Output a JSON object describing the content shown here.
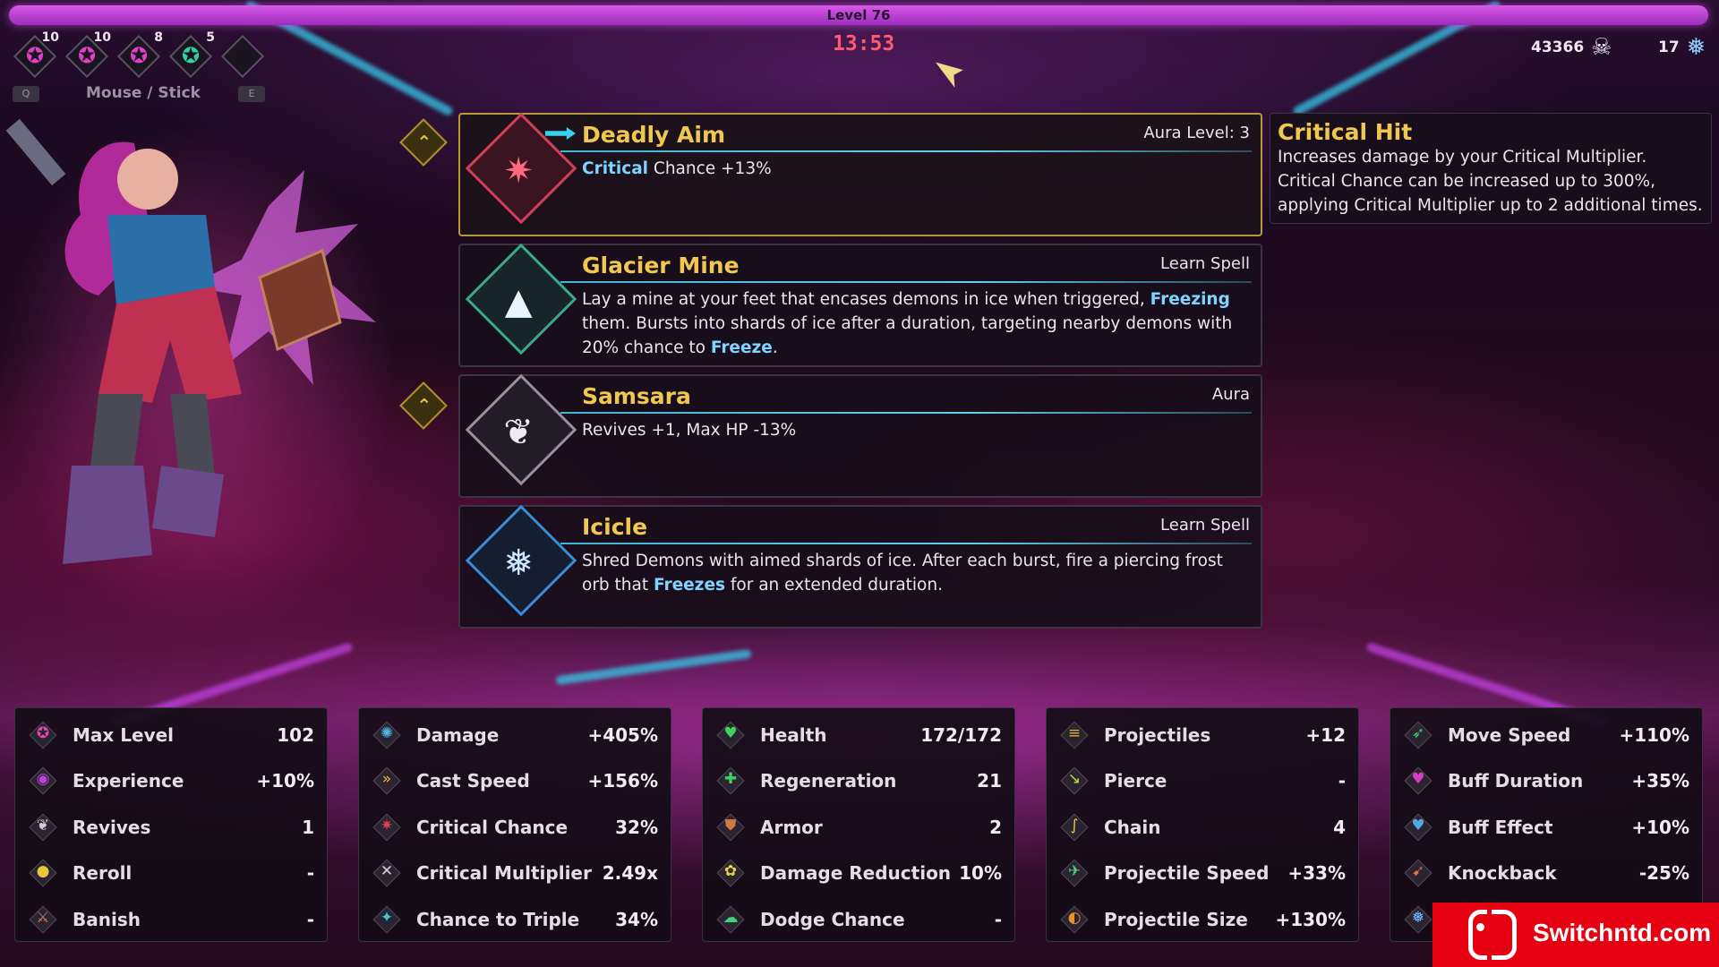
{
  "hud": {
    "level_label": "Level 76",
    "timer": "13:53",
    "gold": "43366",
    "gems": "17",
    "mouse_label": "Mouse / Stick",
    "key_left": "Q",
    "key_right": "E",
    "badges": [
      {
        "count": "10",
        "color": "#e040c8",
        "icon": "star-pink"
      },
      {
        "count": "10",
        "color": "#e040c8",
        "icon": "star-pink"
      },
      {
        "count": "8",
        "color": "#e040c8",
        "icon": "star-pink"
      },
      {
        "count": "5",
        "color": "#30d0a8",
        "icon": "star-teal"
      },
      {
        "count": "",
        "color": "#3a3340",
        "icon": "empty-slot"
      }
    ]
  },
  "offers": [
    {
      "name": "Deadly Aim",
      "tag": "Aura Level: 3",
      "desc_html": "<b>Critical</b> Chance +13%",
      "icon": "crosshair-icon",
      "accent": "#d0405a",
      "glyph": "✷"
    },
    {
      "name": "Glacier Mine",
      "tag": "Learn Spell",
      "desc_html": "Lay a mine at your feet that encases demons in ice when triggered, <b>Freezing</b> them. Bursts into shards of ice after a duration, targeting nearby demons with 20% chance to <b>Freeze</b>.",
      "icon": "ice-mine-icon",
      "accent": "#3aa88a",
      "glyph": "▲"
    },
    {
      "name": "Samsara",
      "tag": "Aura",
      "desc_html": "Revives +1, Max HP -13%",
      "icon": "winged-icon",
      "accent": "#9a8ea2",
      "glyph": "❦"
    },
    {
      "name": "Icicle",
      "tag": "Learn Spell",
      "desc_html": "Shred Demons with aimed shards of ice. After each burst, fire a piercing frost orb that <b>Freezes</b> for an extended duration.",
      "icon": "icicle-icon",
      "accent": "#3a8ad8",
      "glyph": "❅"
    }
  ],
  "tooltip": {
    "title": "Critical Hit",
    "body": "Increases damage by your Critical Multiplier. Critical Chance can be increased up to 300%, applying Critical Multiplier up to 2 additional times."
  },
  "stats": [
    [
      {
        "label": "Max Level",
        "value": "102",
        "icon": "max-level-icon",
        "glyph": "✪",
        "color": "#e04aa8"
      },
      {
        "label": "Experience",
        "value": "+10%",
        "icon": "experience-icon",
        "glyph": "◉",
        "color": "#c040e0"
      },
      {
        "label": "Revives",
        "value": "1",
        "icon": "revives-icon",
        "glyph": "❦",
        "color": "#d0c8d8"
      },
      {
        "label": "Reroll",
        "value": "-",
        "icon": "reroll-icon",
        "glyph": "●",
        "color": "#e8c840"
      },
      {
        "label": "Banish",
        "value": "-",
        "icon": "banish-icon",
        "glyph": "⚔",
        "color": "#c87860"
      }
    ],
    [
      {
        "label": "Damage",
        "value": "+405%",
        "icon": "damage-icon",
        "glyph": "✺",
        "color": "#50b8d8"
      },
      {
        "label": "Cast Speed",
        "value": "+156%",
        "icon": "cast-speed-icon",
        "glyph": "»",
        "color": "#f0c030"
      },
      {
        "label": "Critical Chance",
        "value": "32%",
        "icon": "critical-chance-icon",
        "glyph": "✷",
        "color": "#e04050"
      },
      {
        "label": "Critical Multiplier",
        "value": "2.49x",
        "icon": "critical-multiplier-icon",
        "glyph": "✕",
        "color": "#d8d0e0"
      },
      {
        "label": "Chance to Triple",
        "value": "34%",
        "icon": "triple-icon",
        "glyph": "✦",
        "color": "#40c0d0"
      }
    ],
    [
      {
        "label": "Health",
        "value": "172/172",
        "icon": "health-icon",
        "glyph": "♥",
        "color": "#40d060"
      },
      {
        "label": "Regeneration",
        "value": "21",
        "icon": "regeneration-icon",
        "glyph": "✚",
        "color": "#40d060"
      },
      {
        "label": "Armor",
        "value": "2",
        "icon": "armor-icon",
        "glyph": "⛊",
        "color": "#d07840"
      },
      {
        "label": "Damage Reduction",
        "value": "10%",
        "icon": "damage-reduction-icon",
        "glyph": "✿",
        "color": "#e8d040"
      },
      {
        "label": "Dodge Chance",
        "value": "-",
        "icon": "dodge-icon",
        "glyph": "☁",
        "color": "#40d080"
      }
    ],
    [
      {
        "label": "Projectiles",
        "value": "+12",
        "icon": "projectiles-icon",
        "glyph": "≡",
        "color": "#e8a830"
      },
      {
        "label": "Pierce",
        "value": "-",
        "icon": "pierce-icon",
        "glyph": "↘",
        "color": "#c8e040"
      },
      {
        "label": "Chain",
        "value": "4",
        "icon": "chain-icon",
        "glyph": "∫",
        "color": "#e8c840"
      },
      {
        "label": "Projectile Speed",
        "value": "+33%",
        "icon": "projectile-speed-icon",
        "glyph": "✈",
        "color": "#50d080"
      },
      {
        "label": "Projectile Size",
        "value": "+130%",
        "icon": "projectile-size-icon",
        "glyph": "◐",
        "color": "#e89030"
      }
    ],
    [
      {
        "label": "Move Speed",
        "value": "+110%",
        "icon": "move-speed-icon",
        "glyph": "➶",
        "color": "#40d070"
      },
      {
        "label": "Buff Duration",
        "value": "+35%",
        "icon": "buff-duration-icon",
        "glyph": "♥",
        "color": "#d040c0"
      },
      {
        "label": "Buff Effect",
        "value": "+10%",
        "icon": "buff-effect-icon",
        "glyph": "♥",
        "color": "#50a8e8"
      },
      {
        "label": "Knockback",
        "value": "-25%",
        "icon": "knockback-icon",
        "glyph": "➹",
        "color": "#e07040"
      },
      {
        "label": "",
        "value": "",
        "icon": "freeze-icon",
        "glyph": "❅",
        "color": "#7fb8ff"
      }
    ]
  ],
  "watermark": {
    "text": "Switchntd.com"
  }
}
